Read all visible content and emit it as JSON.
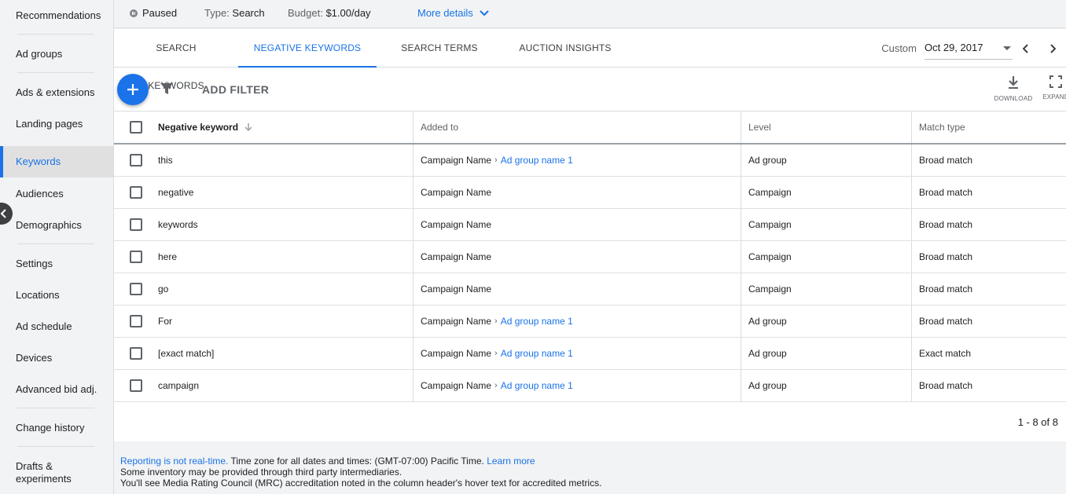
{
  "sidebar": {
    "items": [
      {
        "label": "Recommendations"
      },
      {
        "label": "Ad groups"
      },
      {
        "label": "Ads & extensions"
      },
      {
        "label": "Landing pages"
      },
      {
        "label": "Keywords",
        "active": true
      },
      {
        "label": "Audiences"
      },
      {
        "label": "Demographics"
      },
      {
        "label": "Settings"
      },
      {
        "label": "Locations"
      },
      {
        "label": "Ad schedule"
      },
      {
        "label": "Devices"
      },
      {
        "label": "Advanced bid adj."
      },
      {
        "label": "Change history"
      },
      {
        "label": "Drafts &"
      },
      {
        "label": "experiments"
      }
    ]
  },
  "status": {
    "state": "Paused",
    "type_label": "Type:",
    "type_value": "Search",
    "budget_label": "Budget:",
    "budget_value": "$1.00/day",
    "more_details": "More details"
  },
  "tabs": [
    {
      "label": "SEARCH KEYWORDS"
    },
    {
      "label": "NEGATIVE KEYWORDS",
      "active": true
    },
    {
      "label": "SEARCH TERMS"
    },
    {
      "label": "AUCTION INSIGHTS"
    }
  ],
  "date": {
    "label": "Custom",
    "value": "Oct 29, 2017"
  },
  "toolbar": {
    "add_filter": "ADD FILTER",
    "download": "DOWNLOAD",
    "expand": "EXPAND"
  },
  "table": {
    "columns": [
      "Negative keyword",
      "Added to",
      "Level",
      "Match type"
    ],
    "rows": [
      {
        "keyword": "this",
        "campaign": "Campaign Name",
        "ad_group": "Ad group name 1",
        "level": "Ad group",
        "match": "Broad match"
      },
      {
        "keyword": "negative",
        "campaign": "Campaign Name",
        "ad_group": "",
        "level": "Campaign",
        "match": "Broad match"
      },
      {
        "keyword": "keywords",
        "campaign": "Campaign Name",
        "ad_group": "",
        "level": "Campaign",
        "match": "Broad match"
      },
      {
        "keyword": "here",
        "campaign": "Campaign Name",
        "ad_group": "",
        "level": "Campaign",
        "match": "Broad match"
      },
      {
        "keyword": "go",
        "campaign": "Campaign Name",
        "ad_group": "",
        "level": "Campaign",
        "match": "Broad match"
      },
      {
        "keyword": "For",
        "campaign": "Campaign Name",
        "ad_group": "Ad group name 1",
        "level": "Ad group",
        "match": "Broad match"
      },
      {
        "keyword": "[exact match]",
        "campaign": "Campaign Name",
        "ad_group": "Ad group name 1",
        "level": "Ad group",
        "match": "Exact match"
      },
      {
        "keyword": "campaign",
        "campaign": "Campaign Name",
        "ad_group": "Ad group name 1",
        "level": "Ad group",
        "match": "Broad match"
      }
    ],
    "pager": "1 - 8 of 8"
  },
  "footer": {
    "not_realtime": "Reporting is not real-time.",
    "timezone": " Time zone for all dates and times: (GMT-07:00) Pacific Time. ",
    "learn_more": "Learn more",
    "line2": "Some inventory may be provided through third party intermediaries.",
    "line3": "You'll see Media Rating Council (MRC) accreditation noted in the column header's hover text for accredited metrics."
  },
  "colors": {
    "accent": "#1a73e8",
    "sidebar_bg": "#f1f3f4",
    "active_item_bg": "#e0e0e0"
  }
}
